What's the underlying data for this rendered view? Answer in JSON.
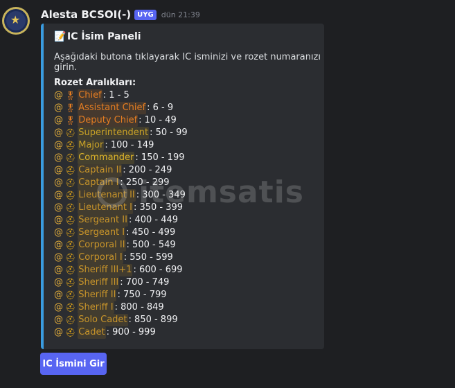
{
  "message": {
    "username": "Alesta BCSOI(-)",
    "tag": "UYG",
    "timestamp": "dün 21:39"
  },
  "embed": {
    "title": "IC İsim Paneli",
    "description": "Aşağıdaki butona tıklayarak IC isminizi ve rozet numaranızı girin.",
    "ranges_title": "Rozet Aralıkları:",
    "rows": [
      {
        "at": "@",
        "icon": "medal-icon",
        "role": "Chief",
        "range": ": 1 - 5",
        "color": "#e67e22"
      },
      {
        "at": "@",
        "icon": "medal-icon",
        "role": "Assistant Chief",
        "range": ": 6 - 9",
        "color": "#e67e22"
      },
      {
        "at": "@",
        "icon": "medal-icon",
        "role": "Deputy Chief",
        "range": ": 10 - 49",
        "color": "#e67e22"
      },
      {
        "at": "@",
        "icon": "hat-icon",
        "role": "Superintendent",
        "range": ": 50 - 99",
        "color": "#c9a227"
      },
      {
        "at": "@",
        "icon": "hat-icon",
        "role": "Major",
        "range": ": 100 - 149",
        "color": "#c9a227"
      },
      {
        "at": "@",
        "icon": "hat-icon",
        "role": "Commander",
        "range": ": 150 - 199",
        "color": "#e0b62a"
      },
      {
        "at": "@",
        "icon": "hat-icon",
        "role": "Captain II",
        "range": ": 200 - 249",
        "color": "#c9952a"
      },
      {
        "at": "@",
        "icon": "hat-icon",
        "role": "Captain I",
        "range": ": 250 - 299",
        "color": "#c9952a"
      },
      {
        "at": "@",
        "icon": "hat-icon",
        "role": "Lieutenant II",
        "range": ": 300 - 349",
        "color": "#c9952a"
      },
      {
        "at": "@",
        "icon": "hat-icon",
        "role": "Lieutenant I",
        "range": ": 350 - 399",
        "color": "#c9952a"
      },
      {
        "at": "@",
        "icon": "hat-icon",
        "role": "Sergeant II",
        "range": ": 400 - 449",
        "color": "#c9952a"
      },
      {
        "at": "@",
        "icon": "hat-icon",
        "role": "Sergeant I",
        "range": ": 450 - 499",
        "color": "#c9952a"
      },
      {
        "at": "@",
        "icon": "hat-icon",
        "role": "Corporal II",
        "range": ": 500 - 549",
        "color": "#c9952a"
      },
      {
        "at": "@",
        "icon": "hat-icon",
        "role": "Corporal I",
        "range": ": 550 - 599",
        "color": "#c9952a"
      },
      {
        "at": "@",
        "icon": "hat-icon",
        "role": "Sheriff III+1",
        "range": ": 600 - 699",
        "color": "#c9952a"
      },
      {
        "at": "@",
        "icon": "hat-icon",
        "role": "Sheriff III",
        "range": ": 700 - 749",
        "color": "#c9952a"
      },
      {
        "at": "@",
        "icon": "hat-icon",
        "role": "Sheriff II",
        "range": ": 750 - 799",
        "color": "#c9952a"
      },
      {
        "at": "@",
        "icon": "hat-icon",
        "role": "Sheriff I",
        "range": ": 800 - 849",
        "color": "#c9952a"
      },
      {
        "at": "@",
        "icon": "hat-icon",
        "role": "Solo Cadet",
        "range": ": 850 - 899",
        "color": "#c9952a"
      },
      {
        "at": "@",
        "icon": "hat-icon",
        "role": "Cadet",
        "range": ": 900 - 999",
        "color": "#c9952a"
      }
    ]
  },
  "button": {
    "label": "IC İsmini Gir"
  },
  "watermark": {
    "text": "itemsatis"
  }
}
